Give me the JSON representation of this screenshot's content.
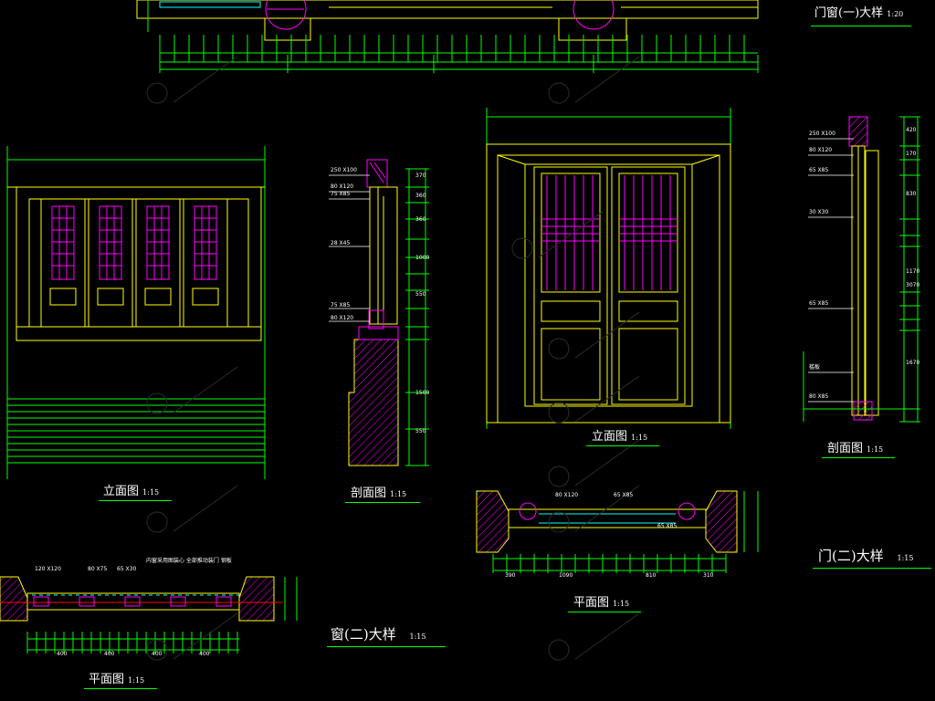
{
  "titles": {
    "door_window_1": {
      "name": "门窗(一)大样",
      "scale": "1:20"
    },
    "window_2": {
      "name": "窗(二)大样",
      "scale": "1:15"
    },
    "door_2": {
      "name": "门(二)大样",
      "scale": "1:15"
    }
  },
  "views": {
    "elevation_left": {
      "name": "立面图",
      "scale": "1:15"
    },
    "section_mid": {
      "name": "剖面图",
      "scale": "1:15"
    },
    "elevation_door": {
      "name": "立面图",
      "scale": "1:15"
    },
    "section_right": {
      "name": "剖面图",
      "scale": "1:15"
    },
    "plan_left": {
      "name": "平面图",
      "scale": "1:15"
    },
    "plan_door": {
      "name": "平面图",
      "scale": "1:15"
    }
  },
  "annotations": {
    "section_mid": [
      "250 X100",
      "80 X120",
      "75 X85",
      "28 X45",
      "75 X85",
      "80 X120"
    ],
    "section_right": [
      "250 X100",
      "80 X120",
      "65 X85",
      "30 X30",
      "65 X85",
      "槛板",
      "80 X85"
    ],
    "plan_door": [
      "80 X120",
      "65 X85",
      "65 X85"
    ],
    "plan_left": [
      "120 X120",
      "80 X75",
      "65 X30"
    ],
    "plan_left_note": "内窗采用图装心 全部推动装门 钢板"
  },
  "dimensions": {
    "plan_left_segments": [
      "400",
      "400",
      "400",
      "400"
    ],
    "plan_door_segments": [
      "390",
      "1090",
      "810",
      "310"
    ],
    "section_mid_vertical": [
      "370",
      "360",
      "360",
      "1000",
      "550",
      "1500",
      "550"
    ],
    "section_right_vertical": [
      "420",
      "170",
      "830",
      "1170",
      "1670",
      "3070"
    ]
  },
  "colors": {
    "background": "#000000",
    "frame": "#ffff00",
    "dimension": "#00ff00",
    "lattice": "#ff00ff",
    "text": "#ffffff",
    "hatch": "#ff00ff",
    "ornament": "#00ffff",
    "axis": "#ff0000"
  }
}
